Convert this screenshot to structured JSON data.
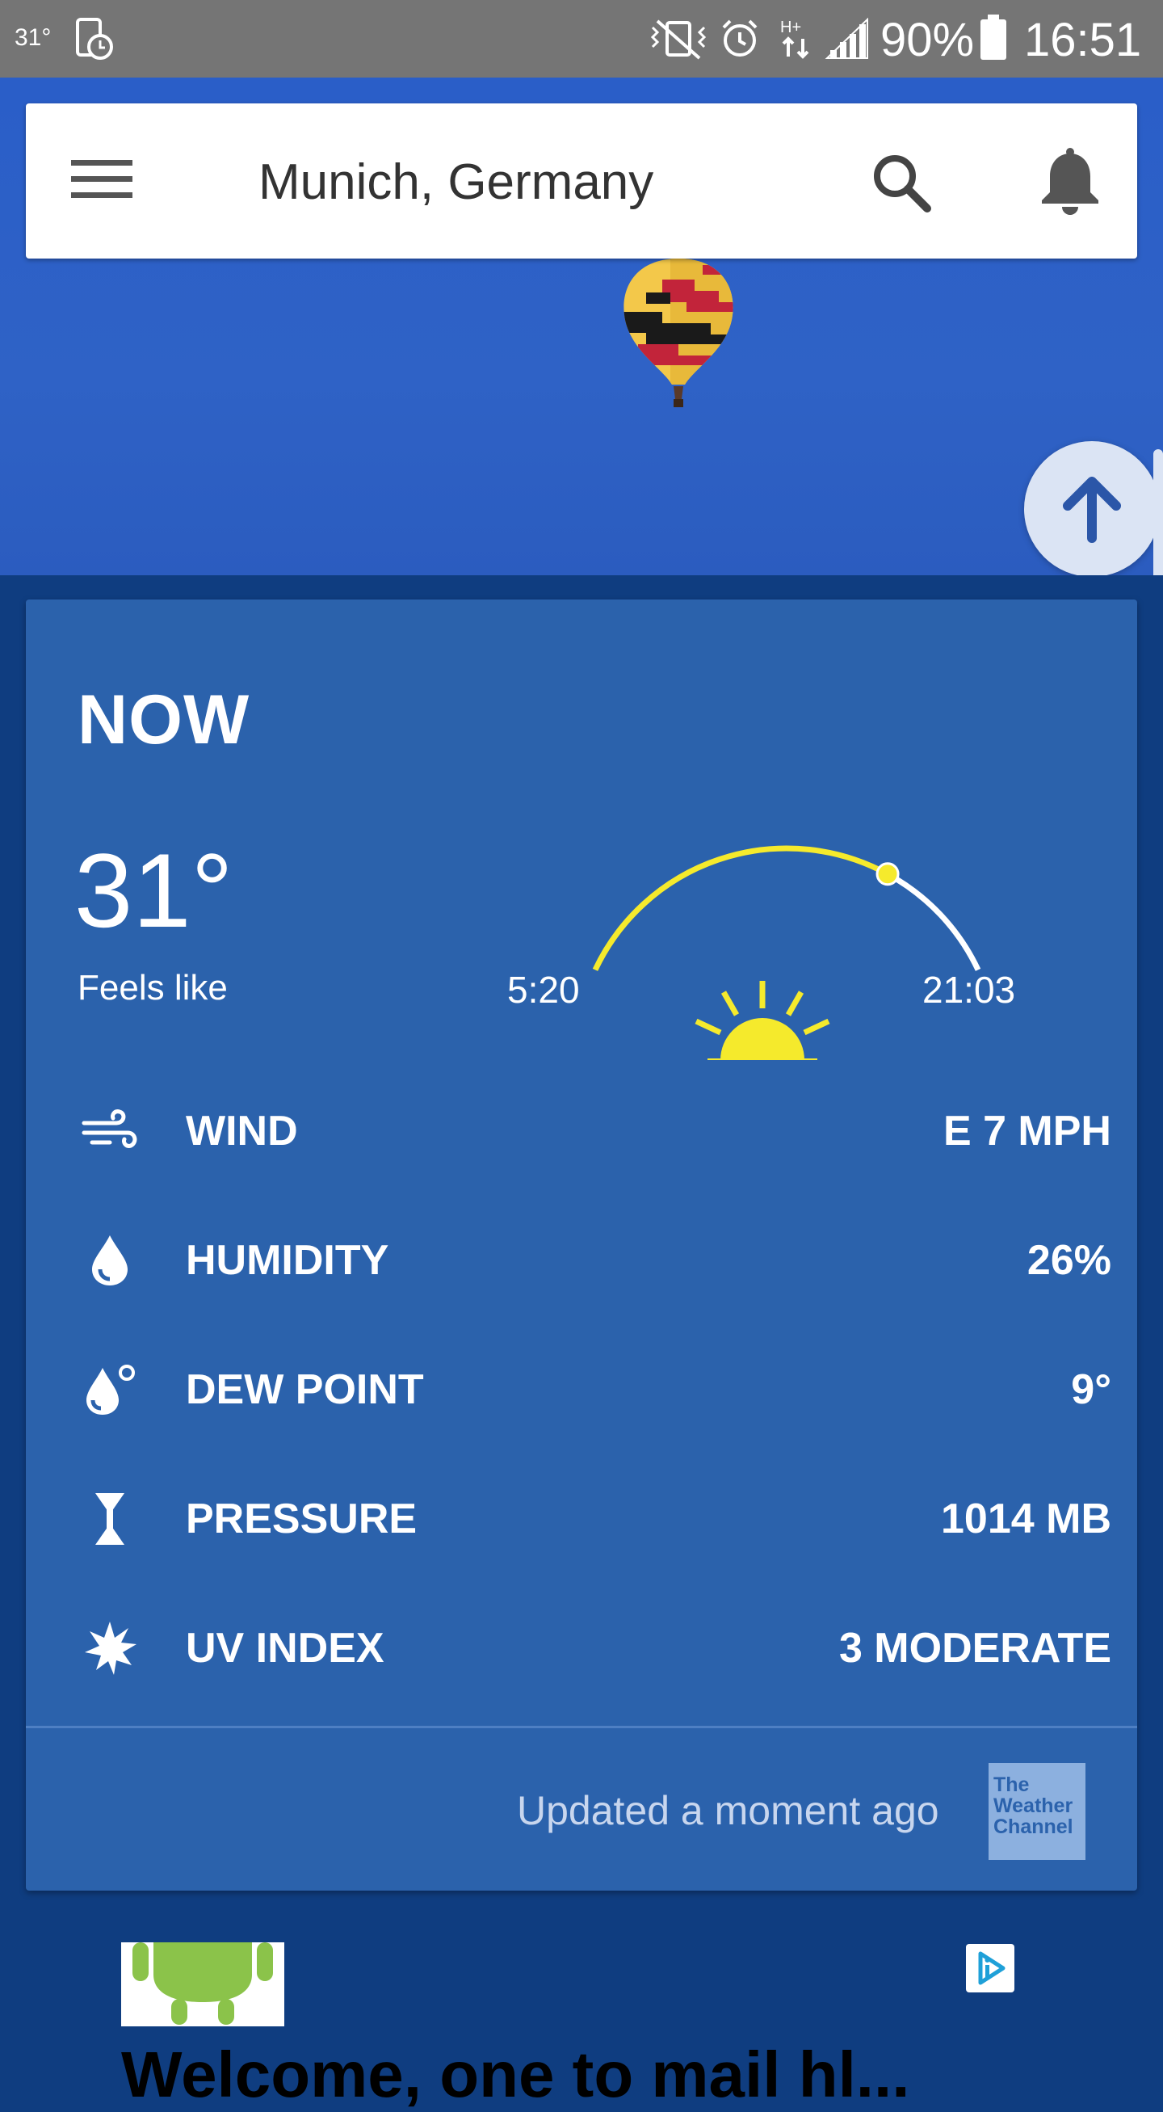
{
  "status_bar": {
    "temperature": "31°",
    "battery": "90%",
    "time": "16:51",
    "icons": [
      "vibrate-off-icon",
      "alarm-icon",
      "data-arrows-icon",
      "signal-icon",
      "battery-icon"
    ]
  },
  "header": {
    "location": "Munich, Germany",
    "icons": [
      "menu-icon",
      "search-icon",
      "notification-bell-icon"
    ]
  },
  "current": {
    "section_title": "NOW",
    "temperature": "31°",
    "feels_like_label": "Feels like",
    "sunrise": "5:20",
    "sunset": "21:03",
    "sun_progress": 0.72,
    "details": [
      {
        "icon": "wind-icon",
        "label": "WIND",
        "value": "E 7 MPH"
      },
      {
        "icon": "humidity-drop-icon",
        "label": "HUMIDITY",
        "value": "26%"
      },
      {
        "icon": "dew-point-icon",
        "label": "DEW POINT",
        "value": "9°"
      },
      {
        "icon": "pressure-icon",
        "label": "PRESSURE",
        "value": "1014 MB"
      },
      {
        "icon": "uv-sun-icon",
        "label": "UV INDEX",
        "value": "3 MODERATE"
      }
    ],
    "updated_text": "Updated a moment ago",
    "provider_logo": "The Weather Channel"
  },
  "ad": {
    "headline": "Welcome, one to mail hl..."
  },
  "colors": {
    "status_bar": "#757575",
    "hero_sky": "#2f62c6",
    "card": "#2b62ac",
    "page_bg": "#0f3d80",
    "sun_yellow": "#f5ea2c"
  }
}
